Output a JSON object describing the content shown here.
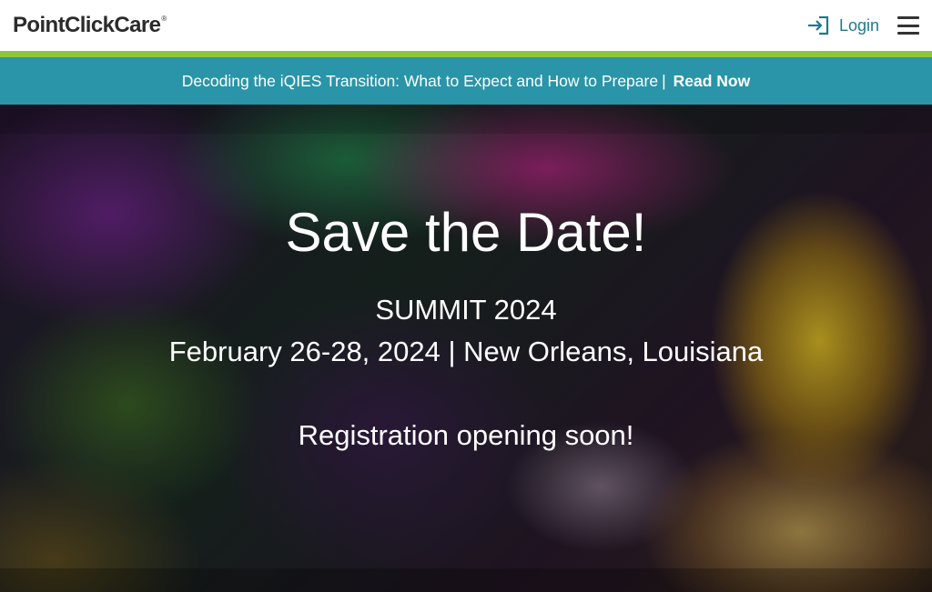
{
  "header": {
    "logo_text": "PointClickCare",
    "logo_reg": "®",
    "login_label": "Login",
    "login_icon": "login-arrow-icon",
    "menu_icon": "hamburger-menu-icon"
  },
  "announcement": {
    "text": "Decoding the iQIES Transition: What to Expect and How to Prepare",
    "separator": "|",
    "link_label": "Read Now"
  },
  "hero": {
    "title": "Save the Date!",
    "event_name": "SUMMIT 2024",
    "dates_location": "February 26-28, 2024 | New Orleans, Louisiana",
    "registration": "Registration opening soon!"
  },
  "colors": {
    "accent_teal": "#2a94a8",
    "accent_green": "#8cc63f",
    "login_text": "#1f7a8c"
  }
}
